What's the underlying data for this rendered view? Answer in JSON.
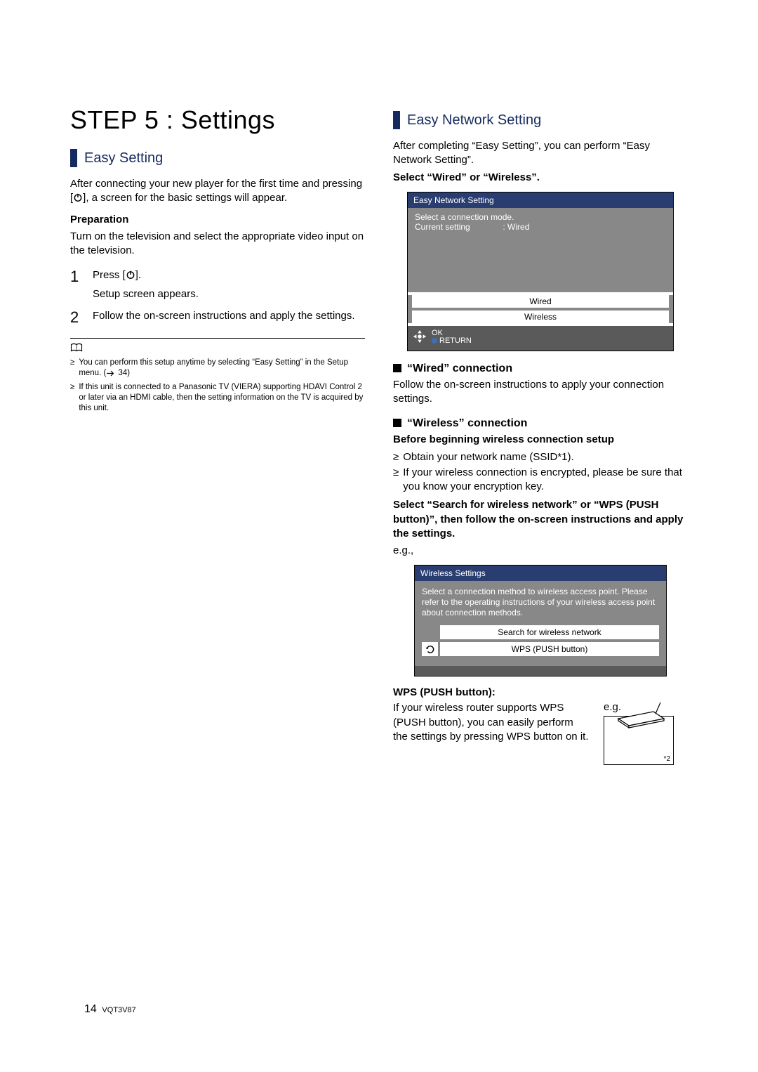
{
  "left": {
    "step_title": "STEP 5 : Settings",
    "easy_setting_heading": "Easy Setting",
    "intro_a": "After connecting your new player for the first time and pressing [",
    "intro_b": "], a screen for the basic settings will appear.",
    "preparation_label": "Preparation",
    "preparation_text": "Turn on the television and select the appropriate video input on the television.",
    "step1_a": "Press [",
    "step1_b": "].",
    "step1_sub": "Setup screen appears.",
    "step2": "Follow the on-screen instructions and apply the settings.",
    "note1_a": "You can perform this setup anytime by selecting “Easy Setting” in the Setup menu. (",
    "note1_ref": " 34)",
    "note2": "If this unit is connected to a Panasonic TV (VIERA) supporting HDAVI Control 2 or later via an HDMI cable, then the setting information on the TV is acquired by this unit."
  },
  "right": {
    "easy_network_heading": "Easy Network Setting",
    "after_text_a": "After completing “Easy Setting”, you can perform “Easy Network Setting”.",
    "select_text": "Select “Wired” or “Wireless”.",
    "panel": {
      "title": "Easy Network Setting",
      "line1": "Select a connection mode.",
      "line2_label": "Current setting",
      "line2_value": ": Wired",
      "opt1": "Wired",
      "opt2": "Wireless",
      "ok": "OK",
      "return": "RETURN"
    },
    "wired_heading": "“Wired” connection",
    "wired_text": "Follow the on-screen instructions to apply your connection settings.",
    "wireless_heading": "“Wireless” connection",
    "wireless_before": "Before beginning wireless connection setup",
    "wireless_b1": "Obtain your network name (SSID*1).",
    "wireless_b2": "If your wireless connection is encrypted, please be sure that you know your encryption key.",
    "wireless_select": "Select “Search for wireless network” or “WPS (PUSH button)”, then follow the on-screen instructions and apply the settings.",
    "eg_label": "e.g.,",
    "panel2": {
      "title": "Wireless Settings",
      "desc": "Select a connection method to wireless access point. Please refer to the operating instructions of your wireless access point about connection methods.",
      "opt1": "Search for wireless network",
      "opt2": "WPS (PUSH button)"
    },
    "wps_title": "WPS (PUSH button):",
    "wps_text": "If your wireless router supports WPS (PUSH button), you can easily perform the settings by pressing WPS button on it.",
    "wps_eg": "e.g.",
    "wps_ref": "*2"
  },
  "footer": {
    "page": "14",
    "code": "VQT3V87"
  }
}
